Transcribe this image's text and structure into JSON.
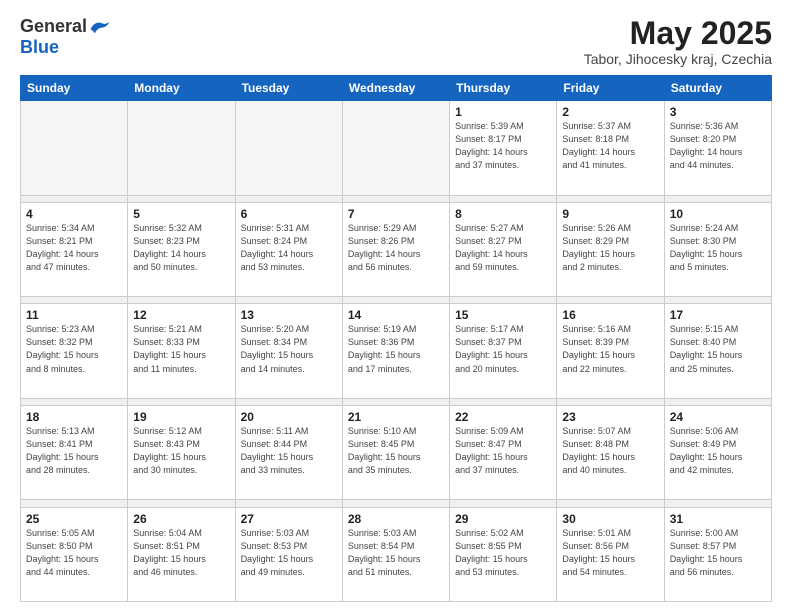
{
  "header": {
    "logo_general": "General",
    "logo_blue": "Blue",
    "month": "May 2025",
    "location": "Tabor, Jihocesky kraj, Czechia"
  },
  "weekdays": [
    "Sunday",
    "Monday",
    "Tuesday",
    "Wednesday",
    "Thursday",
    "Friday",
    "Saturday"
  ],
  "weeks": [
    [
      {
        "day": "",
        "info": ""
      },
      {
        "day": "",
        "info": ""
      },
      {
        "day": "",
        "info": ""
      },
      {
        "day": "",
        "info": ""
      },
      {
        "day": "1",
        "info": "Sunrise: 5:39 AM\nSunset: 8:17 PM\nDaylight: 14 hours\nand 37 minutes."
      },
      {
        "day": "2",
        "info": "Sunrise: 5:37 AM\nSunset: 8:18 PM\nDaylight: 14 hours\nand 41 minutes."
      },
      {
        "day": "3",
        "info": "Sunrise: 5:36 AM\nSunset: 8:20 PM\nDaylight: 14 hours\nand 44 minutes."
      }
    ],
    [
      {
        "day": "4",
        "info": "Sunrise: 5:34 AM\nSunset: 8:21 PM\nDaylight: 14 hours\nand 47 minutes."
      },
      {
        "day": "5",
        "info": "Sunrise: 5:32 AM\nSunset: 8:23 PM\nDaylight: 14 hours\nand 50 minutes."
      },
      {
        "day": "6",
        "info": "Sunrise: 5:31 AM\nSunset: 8:24 PM\nDaylight: 14 hours\nand 53 minutes."
      },
      {
        "day": "7",
        "info": "Sunrise: 5:29 AM\nSunset: 8:26 PM\nDaylight: 14 hours\nand 56 minutes."
      },
      {
        "day": "8",
        "info": "Sunrise: 5:27 AM\nSunset: 8:27 PM\nDaylight: 14 hours\nand 59 minutes."
      },
      {
        "day": "9",
        "info": "Sunrise: 5:26 AM\nSunset: 8:29 PM\nDaylight: 15 hours\nand 2 minutes."
      },
      {
        "day": "10",
        "info": "Sunrise: 5:24 AM\nSunset: 8:30 PM\nDaylight: 15 hours\nand 5 minutes."
      }
    ],
    [
      {
        "day": "11",
        "info": "Sunrise: 5:23 AM\nSunset: 8:32 PM\nDaylight: 15 hours\nand 8 minutes."
      },
      {
        "day": "12",
        "info": "Sunrise: 5:21 AM\nSunset: 8:33 PM\nDaylight: 15 hours\nand 11 minutes."
      },
      {
        "day": "13",
        "info": "Sunrise: 5:20 AM\nSunset: 8:34 PM\nDaylight: 15 hours\nand 14 minutes."
      },
      {
        "day": "14",
        "info": "Sunrise: 5:19 AM\nSunset: 8:36 PM\nDaylight: 15 hours\nand 17 minutes."
      },
      {
        "day": "15",
        "info": "Sunrise: 5:17 AM\nSunset: 8:37 PM\nDaylight: 15 hours\nand 20 minutes."
      },
      {
        "day": "16",
        "info": "Sunrise: 5:16 AM\nSunset: 8:39 PM\nDaylight: 15 hours\nand 22 minutes."
      },
      {
        "day": "17",
        "info": "Sunrise: 5:15 AM\nSunset: 8:40 PM\nDaylight: 15 hours\nand 25 minutes."
      }
    ],
    [
      {
        "day": "18",
        "info": "Sunrise: 5:13 AM\nSunset: 8:41 PM\nDaylight: 15 hours\nand 28 minutes."
      },
      {
        "day": "19",
        "info": "Sunrise: 5:12 AM\nSunset: 8:43 PM\nDaylight: 15 hours\nand 30 minutes."
      },
      {
        "day": "20",
        "info": "Sunrise: 5:11 AM\nSunset: 8:44 PM\nDaylight: 15 hours\nand 33 minutes."
      },
      {
        "day": "21",
        "info": "Sunrise: 5:10 AM\nSunset: 8:45 PM\nDaylight: 15 hours\nand 35 minutes."
      },
      {
        "day": "22",
        "info": "Sunrise: 5:09 AM\nSunset: 8:47 PM\nDaylight: 15 hours\nand 37 minutes."
      },
      {
        "day": "23",
        "info": "Sunrise: 5:07 AM\nSunset: 8:48 PM\nDaylight: 15 hours\nand 40 minutes."
      },
      {
        "day": "24",
        "info": "Sunrise: 5:06 AM\nSunset: 8:49 PM\nDaylight: 15 hours\nand 42 minutes."
      }
    ],
    [
      {
        "day": "25",
        "info": "Sunrise: 5:05 AM\nSunset: 8:50 PM\nDaylight: 15 hours\nand 44 minutes."
      },
      {
        "day": "26",
        "info": "Sunrise: 5:04 AM\nSunset: 8:51 PM\nDaylight: 15 hours\nand 46 minutes."
      },
      {
        "day": "27",
        "info": "Sunrise: 5:03 AM\nSunset: 8:53 PM\nDaylight: 15 hours\nand 49 minutes."
      },
      {
        "day": "28",
        "info": "Sunrise: 5:03 AM\nSunset: 8:54 PM\nDaylight: 15 hours\nand 51 minutes."
      },
      {
        "day": "29",
        "info": "Sunrise: 5:02 AM\nSunset: 8:55 PM\nDaylight: 15 hours\nand 53 minutes."
      },
      {
        "day": "30",
        "info": "Sunrise: 5:01 AM\nSunset: 8:56 PM\nDaylight: 15 hours\nand 54 minutes."
      },
      {
        "day": "31",
        "info": "Sunrise: 5:00 AM\nSunset: 8:57 PM\nDaylight: 15 hours\nand 56 minutes."
      }
    ]
  ]
}
